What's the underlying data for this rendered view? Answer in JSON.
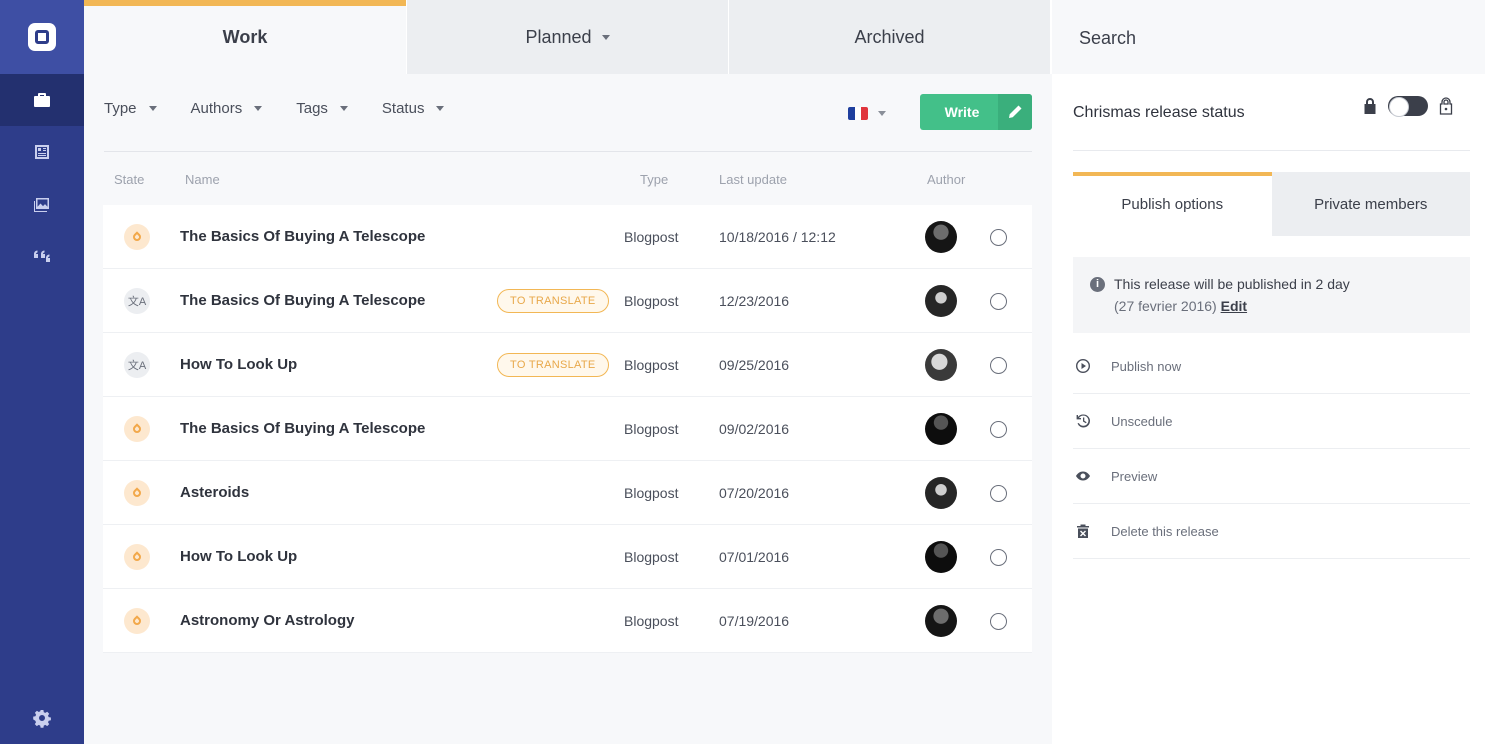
{
  "sidebar": {
    "icons": [
      "logo-icon",
      "briefcase-icon",
      "dashboard-icon",
      "media-icon",
      "quotes-icon",
      "settings-icon"
    ]
  },
  "tabs": {
    "work": "Work",
    "planned": "Planned",
    "archived": "Archived",
    "search": "Search"
  },
  "filters": {
    "type": "Type",
    "authors": "Authors",
    "tags": "Tags",
    "status": "Status"
  },
  "language": {
    "flag": "fr",
    "colors": [
      "#1f3f9e",
      "#ffffff",
      "#e0343c"
    ]
  },
  "write_button": {
    "label": "Write"
  },
  "table": {
    "headers": {
      "state": "State",
      "name": "Name",
      "type": "Type",
      "last_update": "Last update",
      "author": "Author"
    },
    "rows": [
      {
        "state": "draft",
        "name": "The Basics Of Buying A Telescope",
        "badge": "",
        "type": "Blogpost",
        "date": "10/18/2016 / 12:12",
        "avatar": "a"
      },
      {
        "state": "translate",
        "name": "The Basics Of Buying A Telescope",
        "badge": "TO TRANSLATE",
        "type": "Blogpost",
        "date": "12/23/2016",
        "avatar": "b"
      },
      {
        "state": "translate",
        "name": "How To Look Up",
        "badge": "TO TRANSLATE",
        "type": "Blogpost",
        "date": "09/25/2016",
        "avatar": "c"
      },
      {
        "state": "draft",
        "name": "The Basics Of Buying A Telescope",
        "badge": "",
        "type": "Blogpost",
        "date": "09/02/2016",
        "avatar": "d"
      },
      {
        "state": "draft",
        "name": "Asteroids",
        "badge": "",
        "type": "Blogpost",
        "date": "07/20/2016",
        "avatar": "b"
      },
      {
        "state": "draft",
        "name": "How To Look Up",
        "badge": "",
        "type": "Blogpost",
        "date": "07/01/2016",
        "avatar": "d"
      },
      {
        "state": "draft",
        "name": "Astronomy Or Astrology",
        "badge": "",
        "type": "Blogpost",
        "date": "07/19/2016",
        "avatar": "a"
      }
    ]
  },
  "panel": {
    "title": "Chrismas release status",
    "sub_tabs": {
      "publish_options": "Publish options",
      "private_members": "Private members"
    },
    "info": {
      "line1": "This release will be published in 2 day",
      "line2_prefix": "(27 fevrier 2016)",
      "edit": "Edit"
    },
    "actions": [
      {
        "icon": "play-circle-icon",
        "label": "Publish now"
      },
      {
        "icon": "history-icon",
        "label": "Unscedule"
      },
      {
        "icon": "eye-icon",
        "label": "Preview"
      },
      {
        "icon": "trash-icon",
        "label": "Delete this release"
      }
    ]
  },
  "colors": {
    "sidebar": "#2e3d8a",
    "accent_yellow": "#f2b755",
    "write_green": "#43c089"
  }
}
